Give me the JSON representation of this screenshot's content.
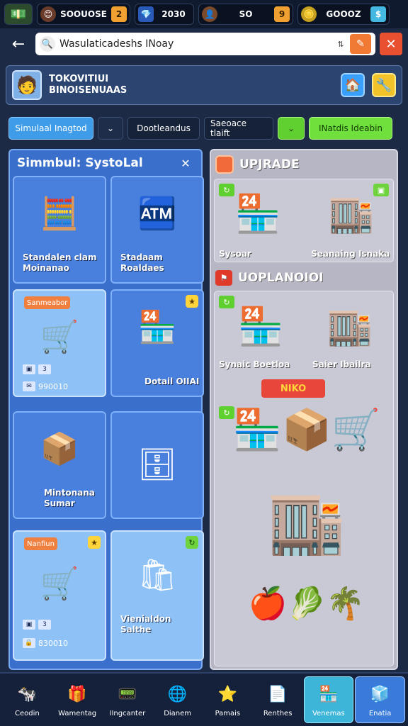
{
  "resources": [
    {
      "icon": "coin-face-icon",
      "glyph": "😊",
      "value": "SOOUOSE",
      "plus": "2"
    },
    {
      "icon": "gem-icon",
      "glyph": "💎",
      "value": "2030",
      "plus": ""
    },
    {
      "icon": "worker-icon",
      "glyph": "👤",
      "value": "SO",
      "plus": "9"
    },
    {
      "icon": "gold-coin-icon",
      "glyph": "🪙",
      "value": "GOOOZ",
      "plus": "$"
    }
  ],
  "search": {
    "value": "Wasulaticadeshs INoay"
  },
  "profile": {
    "line1": "TOKOVITIUI",
    "line2": "BINOISENUAAS"
  },
  "filters": {
    "blue": "Simulaal Inagtod",
    "dark1": "Dootleandus",
    "dark2": "Saeoace tlaift",
    "green": "INatdis Ideabin"
  },
  "left": {
    "title": "Simmbul: SystoLal",
    "cards": [
      {
        "label": "Standalen clam\nMoinanao"
      },
      {
        "label": "Stadaam\nRoaldaes"
      },
      {
        "tag": "Sanmeabor",
        "stat1": "3",
        "stat2": "990010"
      },
      {
        "label": "Dotail\nOIIAI"
      },
      {
        "label": "Mintonana\nSumar"
      },
      {
        "label": ""
      },
      {
        "tag": "Nanfiun",
        "stat1": "3",
        "stat2": "830010"
      },
      {
        "label": "Vienialdon\nSalthe"
      }
    ]
  },
  "right": {
    "title": "UPJRADE",
    "sub": "UOPLANOIOI",
    "shops": [
      {
        "label": "Sysoar"
      },
      {
        "label": "Seanaing Isnaka"
      },
      {
        "label": "Synaic Boetloa"
      },
      {
        "label": "Saier Ibailra"
      }
    ],
    "sign": "NIKO"
  },
  "nav": [
    {
      "icon": "robot-icon",
      "glyph": "🐄",
      "label": "Ceodin"
    },
    {
      "icon": "gift-icon",
      "glyph": "🎁",
      "label": "Wamentag"
    },
    {
      "icon": "device-icon",
      "glyph": "📟",
      "label": "IIngcanter"
    },
    {
      "icon": "globe-icon",
      "glyph": "🌐",
      "label": "Dianem"
    },
    {
      "icon": "star-icon",
      "glyph": "⭐",
      "label": "Pamais"
    },
    {
      "icon": "document-icon",
      "glyph": "📄",
      "label": "Renthes"
    },
    {
      "icon": "store-icon",
      "glyph": "🏪",
      "label": "Venemas"
    },
    {
      "icon": "cube-icon",
      "glyph": "🧊",
      "label": "Enatia"
    }
  ]
}
